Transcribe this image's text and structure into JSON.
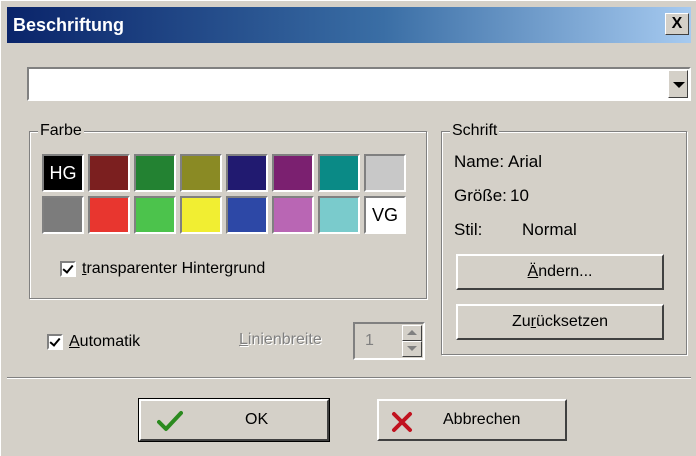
{
  "window": {
    "title": "Beschriftung",
    "close_label": "X"
  },
  "text_combo": {
    "value": ""
  },
  "color_group": {
    "label": "Farbe",
    "swatches": [
      {
        "color": "#000000",
        "text": "HG",
        "text_color": "#ffffff"
      },
      {
        "color": "#7b1f1f",
        "text": ""
      },
      {
        "color": "#238232",
        "text": ""
      },
      {
        "color": "#8a8a24",
        "text": ""
      },
      {
        "color": "#211a70",
        "text": ""
      },
      {
        "color": "#7b2070",
        "text": ""
      },
      {
        "color": "#0a8a86",
        "text": ""
      },
      {
        "color": "#c8c8c8",
        "text": ""
      },
      {
        "color": "#7c7c7c",
        "text": ""
      },
      {
        "color": "#e8362f",
        "text": ""
      },
      {
        "color": "#4cc34c",
        "text": ""
      },
      {
        "color": "#f1ee32",
        "text": ""
      },
      {
        "color": "#2d48a6",
        "text": ""
      },
      {
        "color": "#b966b4",
        "text": ""
      },
      {
        "color": "#7acbcc",
        "text": ""
      },
      {
        "color": "#ffffff",
        "text": "VG",
        "text_color": "#000000"
      }
    ],
    "transparent_label_u": "t",
    "transparent_label_rest": "ransparenter Hintergrund",
    "transparent_checked": true
  },
  "font_group": {
    "label": "Schrift",
    "name_label": "Name:",
    "name_value": "Arial",
    "size_label": "Größe:",
    "size_value": "10",
    "style_label": "Stil:",
    "style_value": "Normal",
    "change_u": "Ä",
    "change_rest": "ndern...",
    "reset_pre": "Zu",
    "reset_u": "r",
    "reset_rest": "ücksetzen"
  },
  "automatic": {
    "u": "A",
    "rest": "utomatik",
    "checked": true
  },
  "line_width": {
    "u": "L",
    "rest": "inienbreite",
    "value": "1"
  },
  "buttons": {
    "ok": "OK",
    "cancel": "Abbrechen"
  },
  "colors": {
    "ok_check": "#2b8a1f",
    "cancel_x": "#c1121f"
  }
}
